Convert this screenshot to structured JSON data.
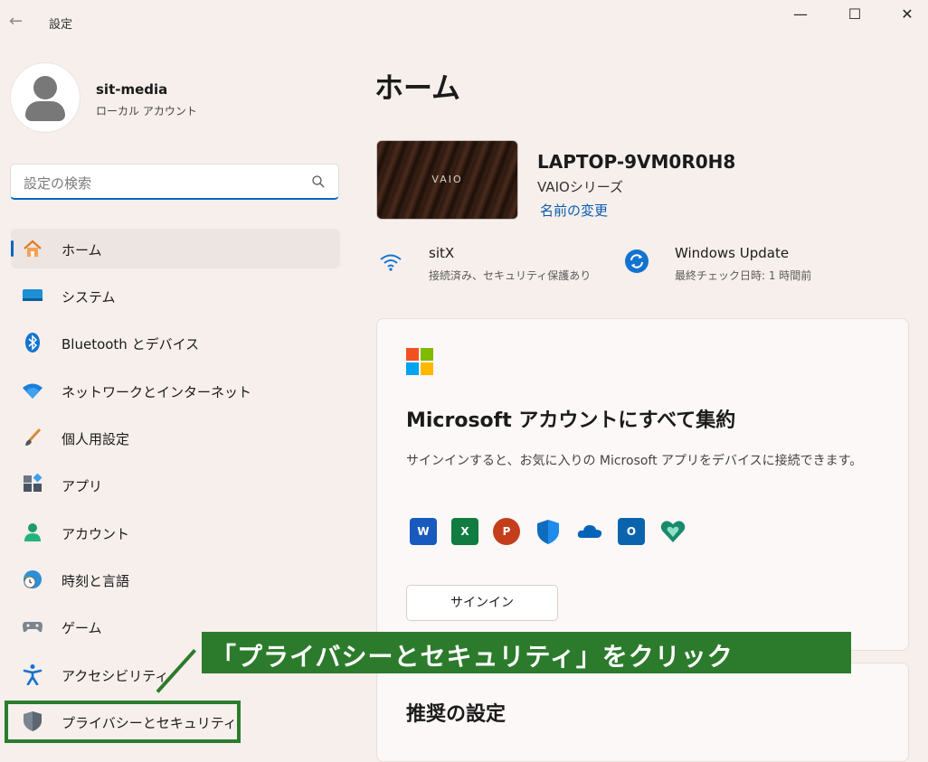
{
  "window": {
    "title": "設定",
    "back_glyph": "←",
    "min_glyph": "—",
    "max_glyph": "☐",
    "close_glyph": "✕"
  },
  "user": {
    "name": "sit-media",
    "account_type": "ローカル アカウント"
  },
  "search": {
    "placeholder": "設定の検索",
    "icon": "search-icon"
  },
  "nav": [
    {
      "label": "ホーム",
      "icon": "home-icon",
      "selected": true
    },
    {
      "label": "システム",
      "icon": "monitor-icon"
    },
    {
      "label": "Bluetooth とデバイス",
      "icon": "bluetooth-icon"
    },
    {
      "label": "ネットワークとインターネット",
      "icon": "wifi-icon"
    },
    {
      "label": "個人用設定",
      "icon": "brush-icon"
    },
    {
      "label": "アプリ",
      "icon": "apps-icon"
    },
    {
      "label": "アカウント",
      "icon": "person-icon"
    },
    {
      "label": "時刻と言語",
      "icon": "clock-globe-icon"
    },
    {
      "label": "ゲーム",
      "icon": "gamepad-icon"
    },
    {
      "label": "アクセシビリティ",
      "icon": "accessibility-icon"
    },
    {
      "label": "プライバシーとセキュリティ",
      "icon": "shield-icon"
    }
  ],
  "main": {
    "title": "ホーム",
    "device": {
      "name": "LAPTOP-9VM0R0H8",
      "series": "VAIOシリーズ",
      "rename_link": "名前の変更",
      "image_logo": "VAIO"
    },
    "wifi": {
      "title": "sitX",
      "subtitle": "接続済み、セキュリティ保護あり"
    },
    "update": {
      "title": "Windows Update",
      "subtitle": "最終チェック日時: 1 時間前"
    },
    "ms_card": {
      "title": "Microsoft アカウントにすべて集約",
      "description": "サインインすると、お気に入りの Microsoft アプリをデバイスに接続できます。",
      "apps": [
        {
          "name": "word-icon",
          "letter": "W",
          "color": "#185abd"
        },
        {
          "name": "excel-icon",
          "letter": "X",
          "color": "#107c41"
        },
        {
          "name": "powerpoint-icon",
          "letter": "P",
          "color": "#c43e1c"
        },
        {
          "name": "defender-icon",
          "letter": "",
          "color": "#0f6cbd"
        },
        {
          "name": "onedrive-icon",
          "letter": "",
          "color": "#0364b8"
        },
        {
          "name": "outlook-icon",
          "letter": "O",
          "color": "#0a64ad"
        },
        {
          "name": "family-safety-icon",
          "letter": "",
          "color": "#1a8a6d"
        }
      ],
      "signin_label": "サインイン"
    },
    "recommended": {
      "title": "推奨の設定"
    }
  },
  "annotation": {
    "callout_text": "「プライバシーとセキュリティ」をクリック",
    "color": "#2c7b2c"
  },
  "colors": {
    "accent": "#0067c0",
    "background": "#f6efec"
  }
}
